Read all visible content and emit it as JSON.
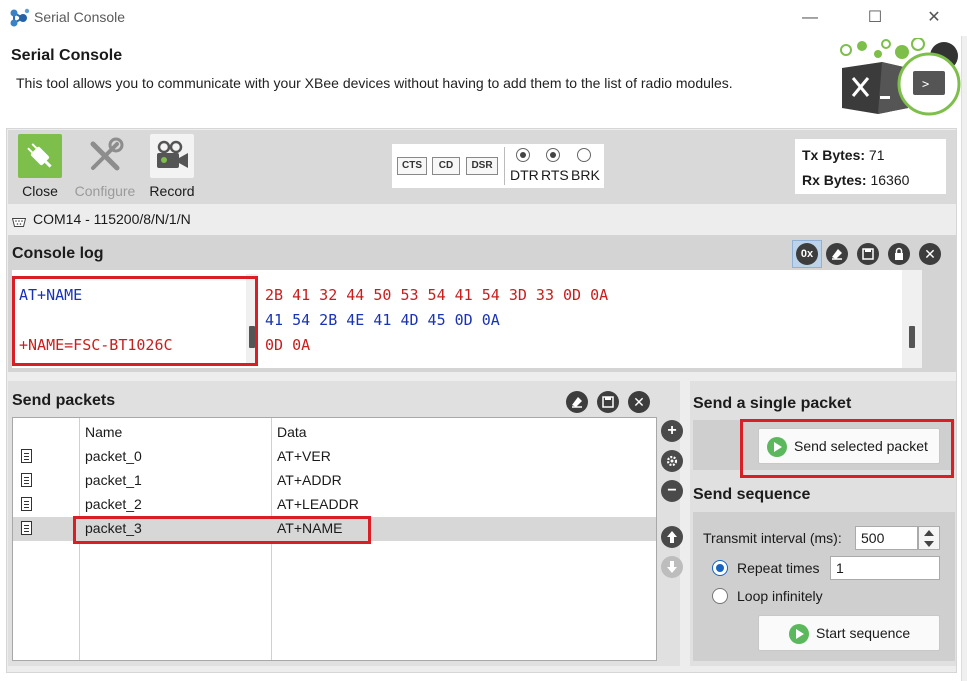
{
  "window": {
    "title": "Serial Console",
    "minimize_glyph": "—",
    "maximize_glyph": "☐",
    "close_glyph": "✕"
  },
  "header": {
    "title": "Serial Console",
    "description": "This tool allows you to communicate with your XBee devices without having to add them to the list of radio modules."
  },
  "toolbar": {
    "close_label": "Close",
    "configure_label": "Configure",
    "record_label": "Record",
    "flags": [
      "CTS",
      "CD",
      "DSR"
    ],
    "lines": [
      {
        "label": "DTR",
        "checked": true
      },
      {
        "label": "RTS",
        "checked": true
      },
      {
        "label": "BRK",
        "checked": false
      }
    ]
  },
  "bytes": {
    "tx_label": "Tx Bytes:",
    "tx_value": "71",
    "rx_label": "Rx Bytes:",
    "rx_value": "16360"
  },
  "connection": {
    "text": "COM14 - 115200/8/N/1/N"
  },
  "console": {
    "title": "Console log",
    "hex_toggle_label": "0x",
    "ascii_lines": [
      {
        "text": "AT+NAME",
        "kind": "sent"
      },
      {
        "text": "+NAME=FSC-BT1026C",
        "kind": "recv"
      }
    ],
    "hex_lines": [
      {
        "text": "2B 41 32 44 50 53 54 41 54 3D 33 0D 0A",
        "kind": "recv"
      },
      {
        "text": "41 54 2B 4E 41 4D 45 0D 0A",
        "kind": "sent"
      },
      {
        "text": "0D 0A",
        "kind": "recv"
      }
    ]
  },
  "send_packets": {
    "title": "Send packets",
    "columns": [
      "Name",
      "Data"
    ],
    "rows": [
      {
        "name": "packet_0",
        "data": "AT+VER"
      },
      {
        "name": "packet_1",
        "data": "AT+ADDR"
      },
      {
        "name": "packet_2",
        "data": "AT+LEADDR"
      },
      {
        "name": "packet_3",
        "data": "AT+NAME"
      }
    ],
    "selected_index": 3
  },
  "single_packet": {
    "title": "Send a single packet",
    "button_label": "Send selected packet"
  },
  "sequence": {
    "title": "Send sequence",
    "interval_label": "Transmit interval (ms):",
    "interval_value": "500",
    "repeat_label": "Repeat times",
    "repeat_value": "1",
    "loop_label": "Loop infinitely",
    "mode": "repeat",
    "button_label": "Start sequence"
  },
  "colors": {
    "highlight": "#d81f26",
    "sent_text": "#1a33b5",
    "recv_text": "#c81e1e",
    "connect_green": "#7dbf4a",
    "play_green": "#5cb85c"
  }
}
